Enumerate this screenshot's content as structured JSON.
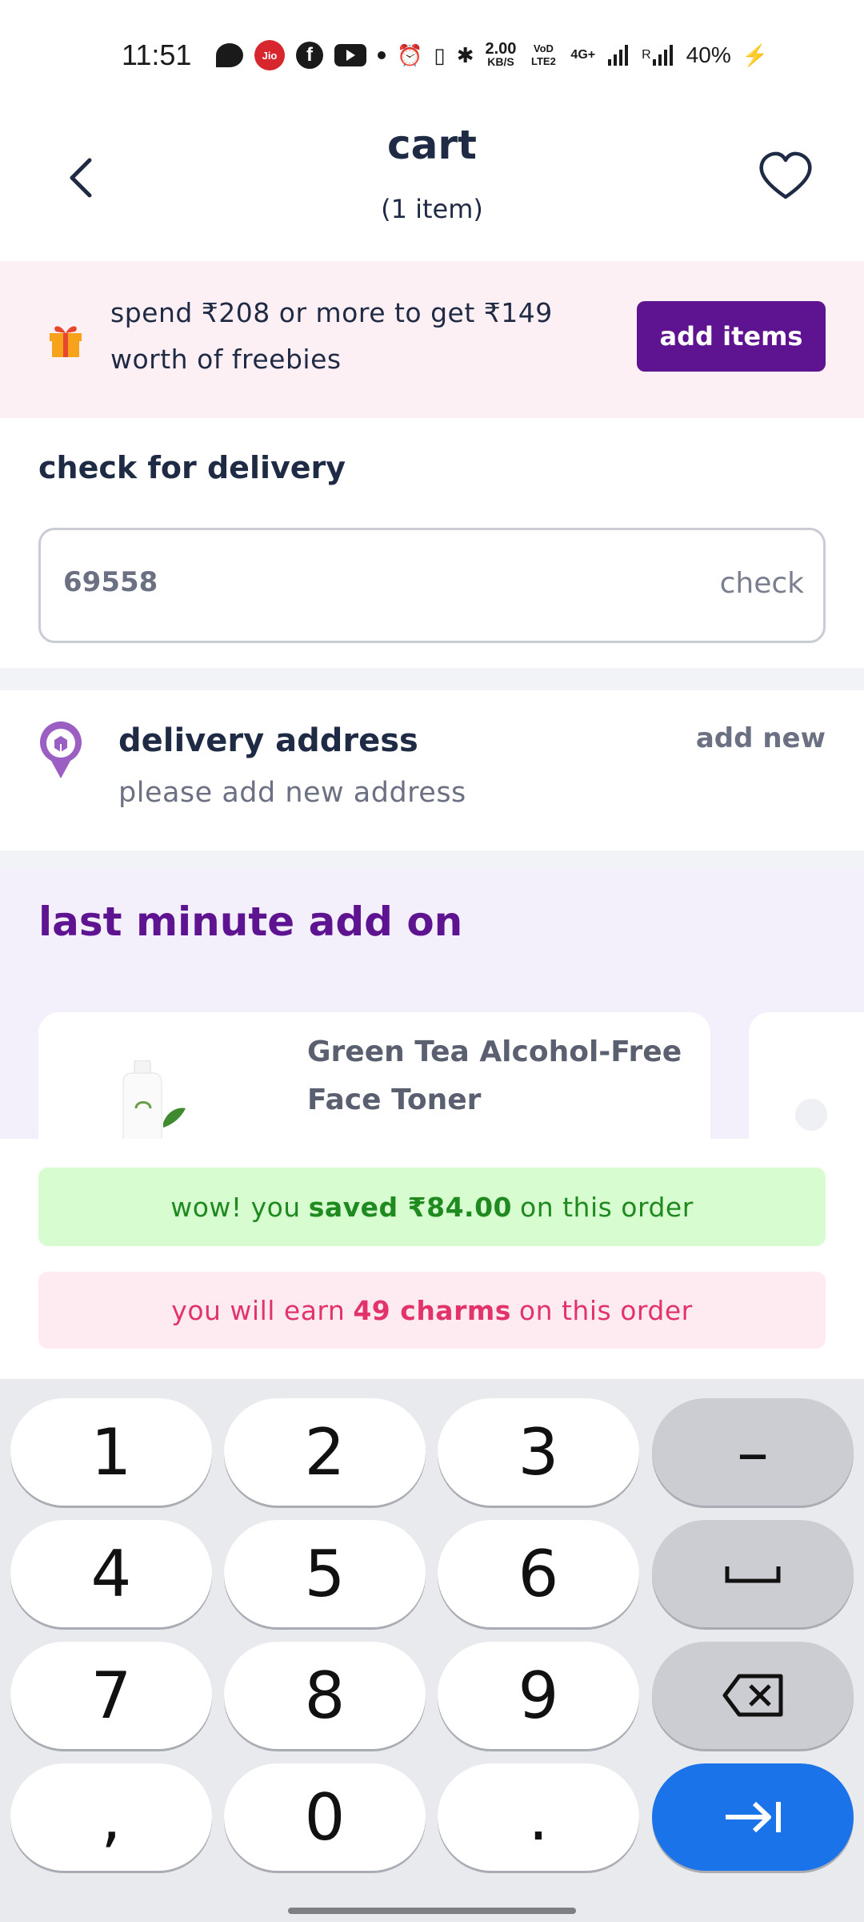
{
  "status_bar": {
    "time": "11:51",
    "carrier_badge": "Jio",
    "net_speed_value": "2.00",
    "net_speed_unit": "KB/S",
    "volte": "VoD LTE2",
    "network": "4G+",
    "roaming": "R",
    "battery": "40%"
  },
  "header": {
    "title": "cart",
    "subtitle": "(1 item)"
  },
  "freebie": {
    "text": "spend ₹208 or more to get ₹149 worth of freebies",
    "button_label": "add items"
  },
  "delivery_check": {
    "title": "check for delivery",
    "pincode_value": "69558",
    "check_label": "check"
  },
  "address": {
    "title": "delivery address",
    "subtitle": "please add new address",
    "add_new_label": "add new"
  },
  "addon": {
    "title": "last minute add on",
    "products": [
      {
        "name": "Green Tea Alcohol-Free Face Toner"
      }
    ]
  },
  "savings": {
    "saved_prefix": "wow! you",
    "saved_bold": "saved ₹84.00",
    "saved_suffix": "on this order",
    "charms_prefix": "you will earn",
    "charms_bold": "49 charms",
    "charms_suffix": "on this order"
  },
  "keyboard": {
    "keys": [
      "1",
      "2",
      "3",
      "–",
      "4",
      "5",
      "6",
      "␣",
      "7",
      "8",
      "9",
      "⌫",
      ",",
      "0",
      ".",
      "→|"
    ]
  },
  "colors": {
    "brand_purple": "#5e1390",
    "saved_green": "#1f8a1f",
    "charms_pink": "#e2336b",
    "keyboard_accent": "#1a73e8"
  }
}
